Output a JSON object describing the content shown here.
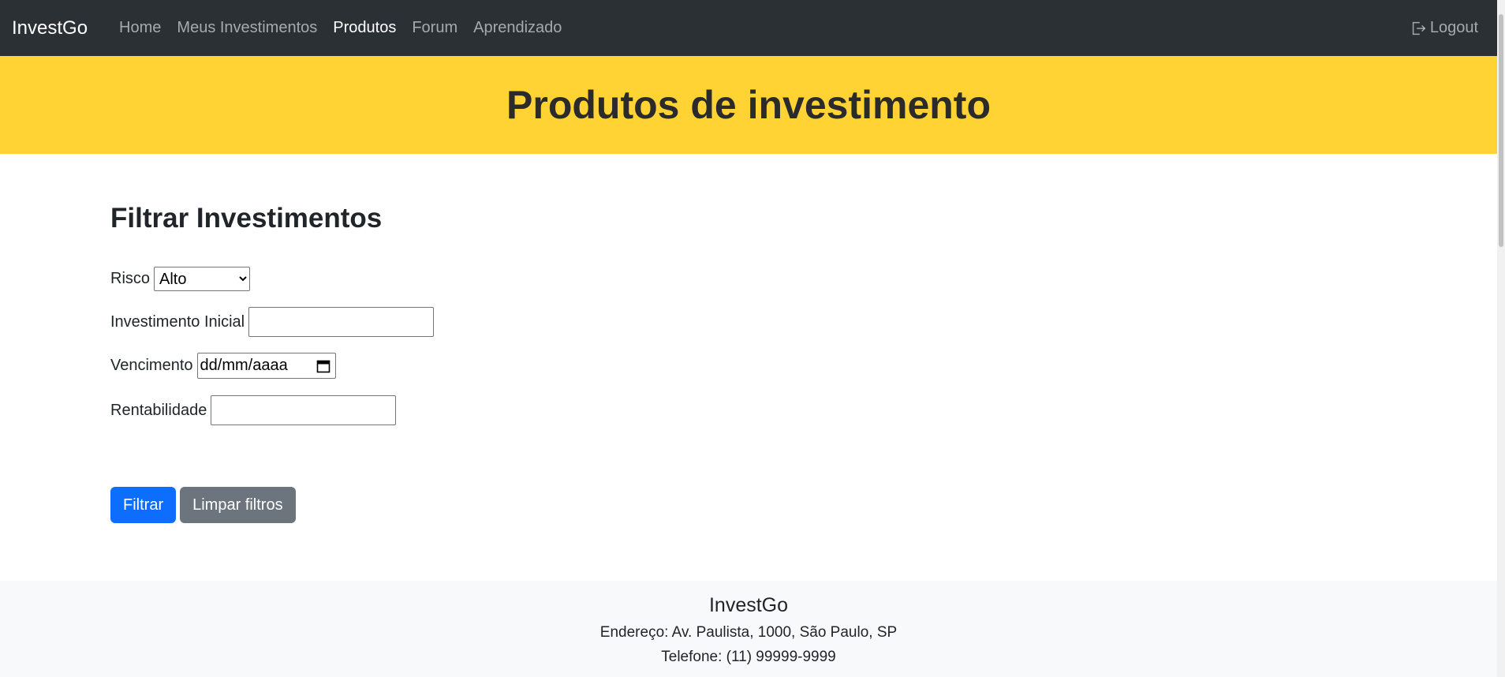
{
  "navbar": {
    "brand": "InvestGo",
    "links": [
      {
        "label": "Home",
        "active": false
      },
      {
        "label": "Meus Investimentos",
        "active": false
      },
      {
        "label": "Produtos",
        "active": true
      },
      {
        "label": "Forum",
        "active": false
      },
      {
        "label": "Aprendizado",
        "active": false
      }
    ],
    "logout_label": "Logout"
  },
  "hero": {
    "title": "Produtos de investimento",
    "background_color": "#ffd333"
  },
  "filter": {
    "title": "Filtrar Investimentos",
    "risco_label": "Risco",
    "risco_selected": "Alto",
    "investimento_inicial_label": "Investimento Inicial",
    "investimento_inicial_value": "",
    "vencimento_label": "Vencimento",
    "vencimento_placeholder": "dd/mm/aaaa",
    "rentabilidade_label": "Rentabilidade",
    "rentabilidade_value": "",
    "filtrar_button": "Filtrar",
    "limpar_button": "Limpar filtros"
  },
  "footer": {
    "title": "InvestGo",
    "address": "Endereço: Av. Paulista, 1000, São Paulo, SP",
    "phone": "Telefone: (11) 99999-9999"
  },
  "colors": {
    "navbar_bg": "#2b3035",
    "primary": "#0d6efd",
    "secondary": "#6c757d",
    "footer_bg": "#f8f9fa"
  }
}
